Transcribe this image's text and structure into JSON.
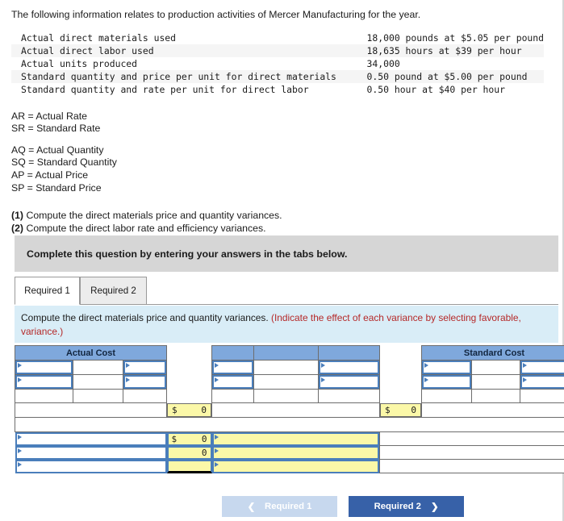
{
  "intro": "The following information relates to production activities of Mercer Manufacturing for the year.",
  "facts": [
    {
      "label": "Actual direct materials used",
      "value": "18,000 pounds at $5.05 per pound"
    },
    {
      "label": "Actual direct labor used",
      "value": "18,635 hours at $39 per hour"
    },
    {
      "label": "Actual units produced",
      "value": "34,000"
    },
    {
      "label": "Standard quantity and price per unit for direct materials",
      "value": "0.50 pound at $5.00 per pound"
    },
    {
      "label": "Standard quantity and rate per unit for direct labor",
      "value": "0.50 hour at $40 per hour"
    }
  ],
  "legend": {
    "group1": [
      "AR = Actual Rate",
      "SR = Standard Rate"
    ],
    "group2": [
      "AQ = Actual Quantity",
      "SQ = Standard Quantity",
      "AP = Actual Price",
      "SP = Standard Price"
    ]
  },
  "requirements": [
    {
      "num": "(1)",
      "text": " Compute the direct materials price and quantity variances."
    },
    {
      "num": "(2)",
      "text": " Compute the direct labor rate and efficiency variances."
    }
  ],
  "banner": "Complete this question by entering your answers in the tabs below.",
  "tabs": [
    {
      "label": "Required 1",
      "active": true
    },
    {
      "label": "Required 2",
      "active": false
    }
  ],
  "prompt": {
    "black": "Compute the direct materials price and quantity variances.",
    "red": "(Indicate the effect of each variance by selecting favorable, variance.)"
  },
  "sheet": {
    "headers": {
      "actual_cost": "Actual Cost",
      "standard_cost": "Standard Cost"
    },
    "totals": {
      "actual": {
        "symbol": "$",
        "amount": "0"
      },
      "standard": {
        "symbol": "$",
        "amount": "0"
      }
    },
    "variance_rows": [
      {
        "symbol": "$",
        "amount": "0",
        "has_symbol": true,
        "black_underline": false
      },
      {
        "symbol": "",
        "amount": "0",
        "has_symbol": false,
        "black_underline": false
      },
      {
        "symbol": "",
        "amount": "",
        "has_symbol": false,
        "black_underline": true
      }
    ]
  },
  "nav": {
    "prev": {
      "label": "Required 1",
      "icon": "chevron-left"
    },
    "next": {
      "label": "Required 2",
      "icon": "chevron-right"
    }
  },
  "colors": {
    "header_blue": "#7fa8dc",
    "input_yellow": "#fbf8a8",
    "prompt_blue": "#d9edf7",
    "banner_grey": "#d6d6d6",
    "accent_red": "#b52828",
    "button_blue": "#3761a8",
    "cell_border_blue": "#4a7ebb"
  }
}
